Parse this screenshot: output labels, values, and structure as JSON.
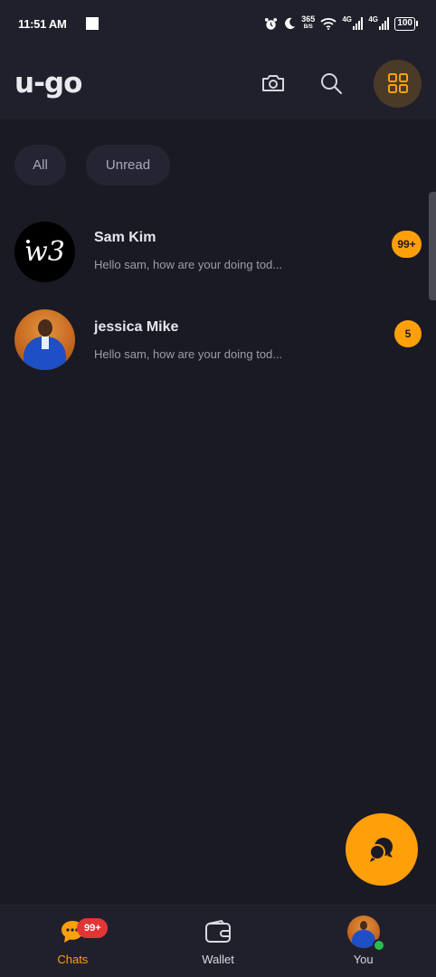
{
  "status_bar": {
    "time": "11:51 AM",
    "net_speed_value": "365",
    "net_speed_unit": "B/S",
    "signal1_label": "4G",
    "signal2_label": "4G",
    "battery": "100",
    "icons": [
      "alarm-icon",
      "moon-icon",
      "wifi-icon",
      "signal-icon",
      "battery-icon"
    ]
  },
  "header": {
    "logo": "u-go",
    "icons": [
      "camera-icon",
      "search-icon",
      "grid-icon"
    ]
  },
  "filters": [
    {
      "label": "All"
    },
    {
      "label": "Unread"
    }
  ],
  "chats": [
    {
      "name": "Sam Kim",
      "preview": "Hello sam, how are your doing tod...",
      "unread": "99+",
      "avatar_text": "w3"
    },
    {
      "name": "jessica Mike",
      "preview": "Hello sam, how are your doing tod...",
      "unread": "5"
    }
  ],
  "fab": {
    "icon": "new-chat-icon"
  },
  "bottom_nav": {
    "items": [
      {
        "label": "Chats",
        "badge": "99+",
        "icon": "chat-bubble-icon",
        "active": true
      },
      {
        "label": "Wallet",
        "icon": "wallet-icon",
        "active": false
      },
      {
        "label": "You",
        "icon": "avatar",
        "active": false
      }
    ]
  },
  "colors": {
    "accent": "#ff9f0a",
    "background": "#1a1a24",
    "surface": "#20202c",
    "badge_red": "#e23636",
    "online": "#2bbd4e"
  }
}
